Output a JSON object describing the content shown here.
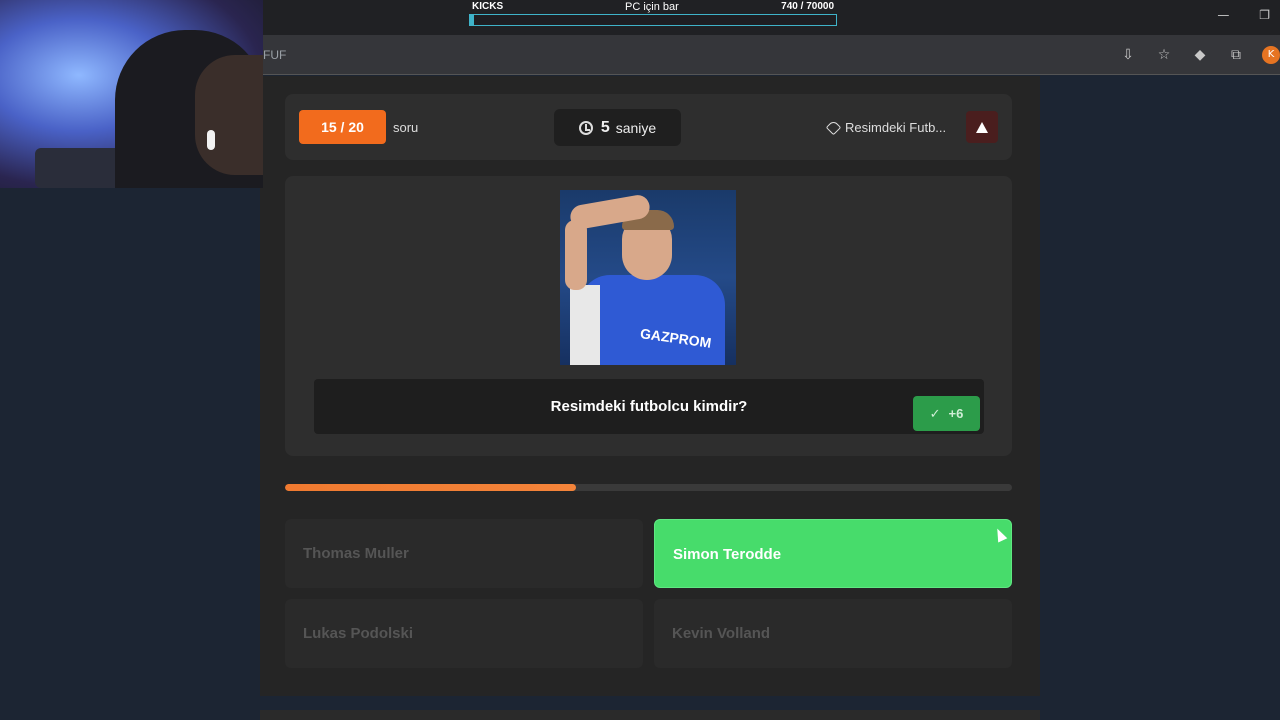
{
  "stream_overlay": {
    "left_label": "KICKS",
    "center_label": "PC için bar",
    "right_label": "740  / 70000",
    "progress_fraction": 0.0106
  },
  "browser": {
    "url_fragment": "FUF",
    "window_controls": [
      "—",
      "❐"
    ],
    "avatar_letter": "K"
  },
  "quiz": {
    "counter": "15 / 20",
    "counter_label": "soru",
    "timer_value": "5",
    "timer_unit": "saniye",
    "category": "Resimdeki Futb...",
    "question": "Resimdeki futbolcu kimdir?",
    "points": "+6",
    "jersey_sponsor": "GAZPROM",
    "progress_fraction": 0.4,
    "answers": [
      {
        "label": "Thomas Muller",
        "state": "dim"
      },
      {
        "label": "Simon Terodde",
        "state": "correct"
      },
      {
        "label": "Lukas Podolski",
        "state": "dim"
      },
      {
        "label": "Kevin Volland",
        "state": "dim"
      }
    ]
  },
  "colors": {
    "accent_orange": "#f26b1d",
    "correct_green": "#47dc6b",
    "points_green": "#2c9c4a",
    "stream_bar": "#3fb3c9"
  }
}
